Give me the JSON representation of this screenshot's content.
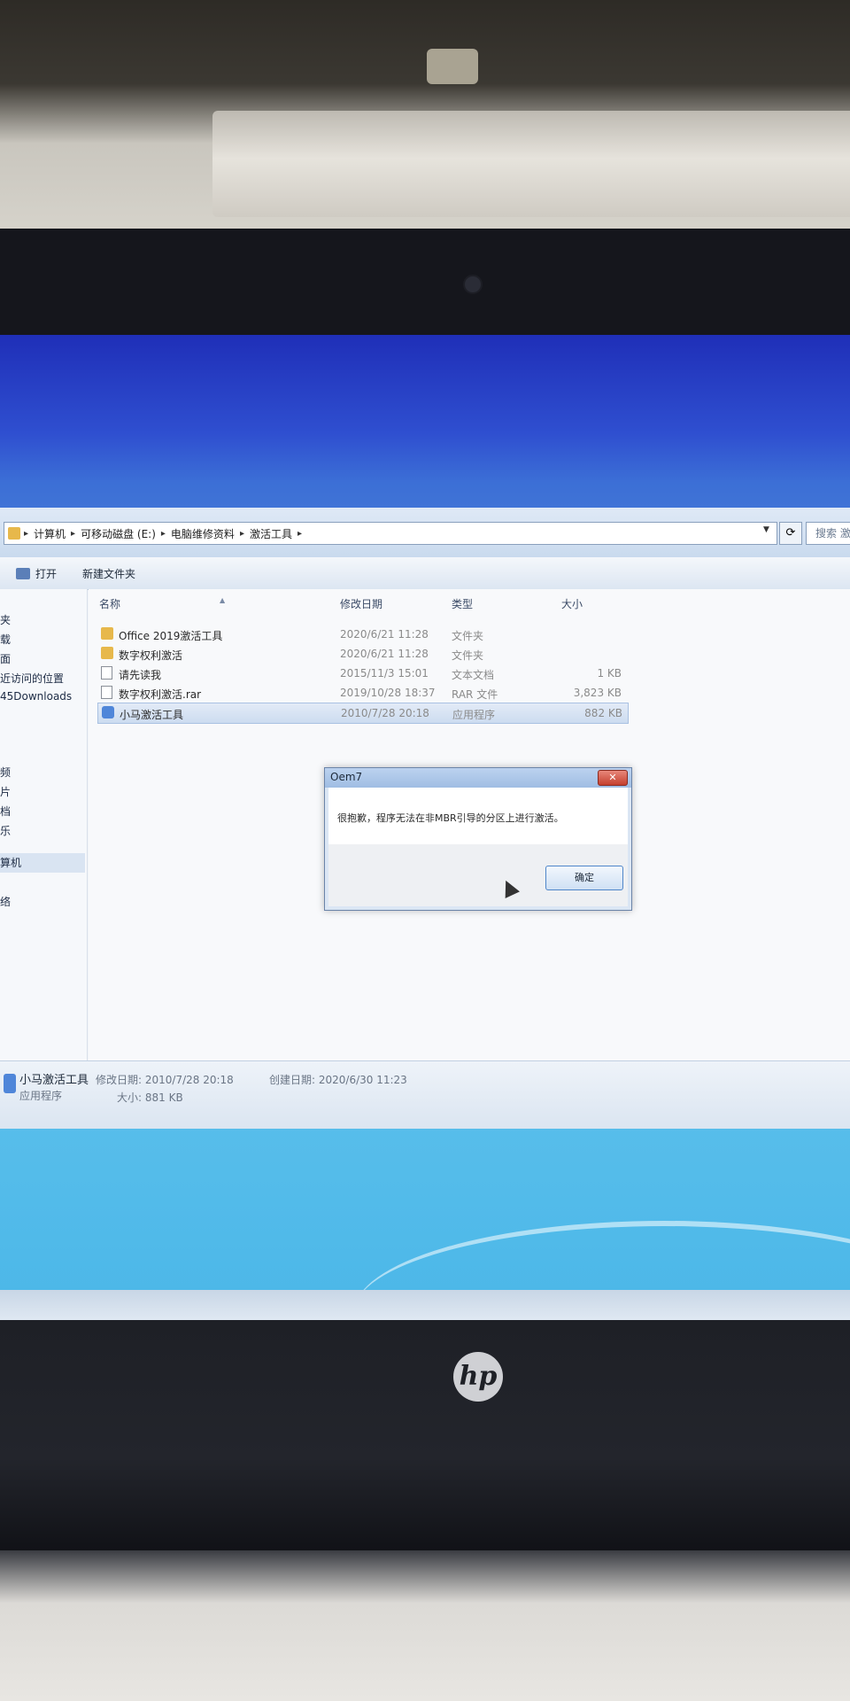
{
  "device": {
    "logo_text": "hp"
  },
  "explorer": {
    "breadcrumb": [
      "计算机",
      "可移动磁盘 (E:)",
      "电脑维修资料",
      "激活工具"
    ],
    "search_placeholder": "搜索 激",
    "toolbar": {
      "open_label": "打开",
      "new_folder_label": "新建文件夹"
    },
    "nav_items": [
      "夹",
      "载",
      "面",
      "近访问的位置",
      "45Downloads",
      "频",
      "片",
      "档",
      "乐",
      "算机",
      "络"
    ],
    "nav_selected_index": 9,
    "columns": {
      "name": "名称",
      "date": "修改日期",
      "type": "类型",
      "size": "大小"
    },
    "files": [
      {
        "name": "Office 2019激活工具",
        "date": "2020/6/21 11:28",
        "type": "文件夹",
        "size": "",
        "icon": "folder-icon"
      },
      {
        "name": "数字权利激活",
        "date": "2020/6/21 11:28",
        "type": "文件夹",
        "size": "",
        "icon": "folder-icon"
      },
      {
        "name": "请先读我",
        "date": "2015/11/3 15:01",
        "type": "文本文档",
        "size": "1 KB",
        "icon": "text-file-icon"
      },
      {
        "name": "数字权利激活.rar",
        "date": "2019/10/28 18:37",
        "type": "RAR 文件",
        "size": "3,823 KB",
        "icon": "rar-file-icon"
      },
      {
        "name": "小马激活工具",
        "date": "2010/7/28 20:18",
        "type": "应用程序",
        "size": "882 KB",
        "icon": "application-icon"
      }
    ],
    "details": {
      "name": "小马激活工具",
      "type": "应用程序",
      "modified_label": "修改日期:",
      "modified_value": "2010/7/28 20:18",
      "size_label": "大小:",
      "size_value": "881 KB",
      "created_label": "创建日期:",
      "created_value": "2020/6/30 11:23"
    }
  },
  "dialog": {
    "title": "Oem7",
    "message": "很抱歉，程序无法在非MBR引导的分区上进行激活。",
    "ok_label": "确定",
    "close_glyph": "✕"
  }
}
